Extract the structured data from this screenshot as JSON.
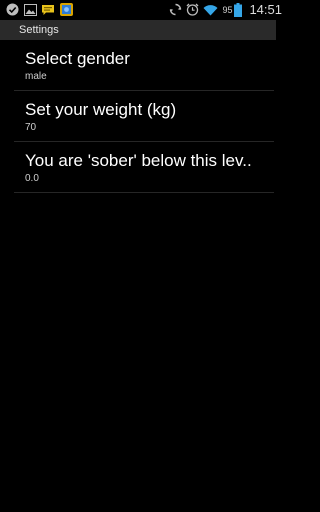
{
  "status_bar": {
    "notification_icons": [
      "check-circle-icon",
      "image-icon",
      "chat-bubble-icon",
      "photo-app-icon"
    ],
    "system_icons": [
      "sync-icon",
      "alarm-icon",
      "wifi-icon",
      "battery-icon"
    ],
    "battery_level": "95",
    "clock": "14:51"
  },
  "title_bar": {
    "title": "Settings"
  },
  "preferences": [
    {
      "title": "Select gender",
      "summary": "male"
    },
    {
      "title": "Set your weight (kg)",
      "summary": "70"
    },
    {
      "title": "You are 'sober' below this lev..",
      "summary": "0.0"
    }
  ]
}
